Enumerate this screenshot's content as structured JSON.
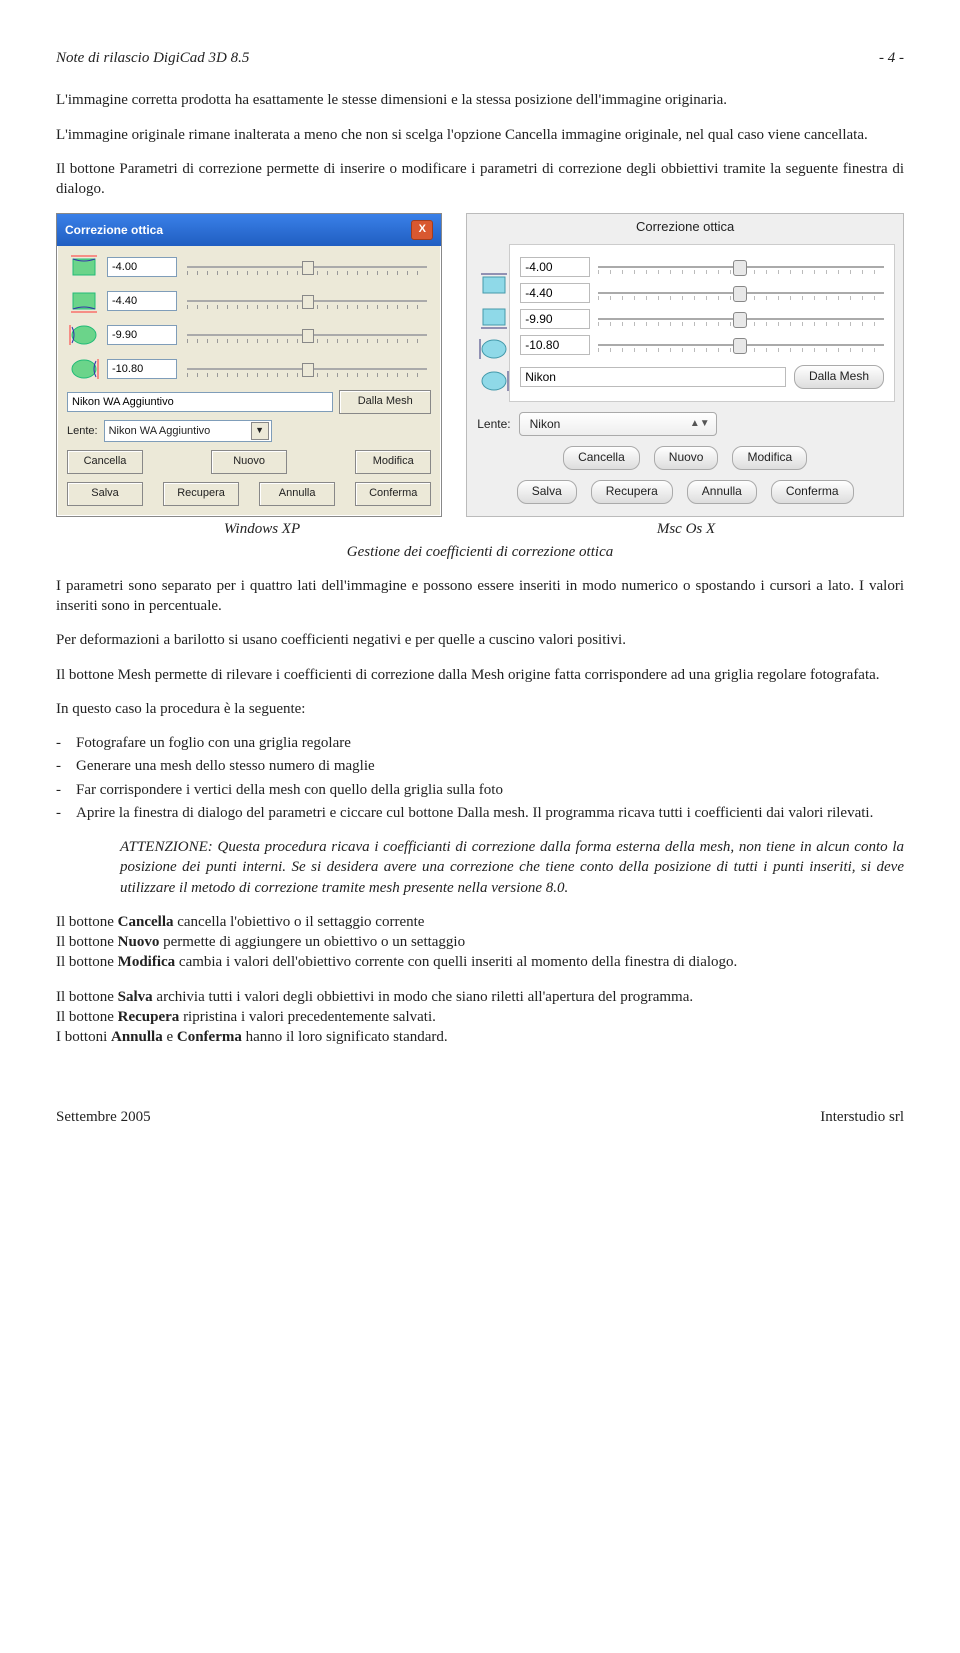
{
  "header": {
    "title": "Note di rilascio DigiCad 3D 8.5",
    "page": "- 4 -"
  },
  "para1": "L'immagine corretta prodotta ha esattamente le stesse dimensioni e la stessa posizione dell'immagine originaria.",
  "para2": "L'immagine originale rimane inalterata a meno che non si scelga l'opzione Cancella immagine originale, nel qual caso viene cancellata.",
  "para3": "Il bottone Parametri di correzione permette di inserire o modificare i parametri di correzione degli obbiettivi tramite la seguente finestra di dialogo.",
  "xp": {
    "title": "Correzione ottica",
    "values": [
      "-4.00",
      "-4.40",
      "-9.90",
      "-10.80"
    ],
    "lensName": "Nikon WA Aggiuntivo",
    "btnMesh": "Dalla Mesh",
    "lenteLabel": "Lente:",
    "combo": "Nikon WA Aggiuntivo",
    "btns1": [
      "Cancella",
      "Nuovo",
      "Modifica"
    ],
    "btns2": [
      "Salva",
      "Recupera",
      "Annulla",
      "Conferma"
    ]
  },
  "mac": {
    "title": "Correzione ottica",
    "values": [
      "-4.00",
      "-4.40",
      "-9.90",
      "-10.80"
    ],
    "lensName": "Nikon",
    "btnMesh": "Dalla Mesh",
    "lenteLabel": "Lente:",
    "combo": "Nikon",
    "btns1": [
      "Cancella",
      "Nuovo",
      "Modifica"
    ],
    "btns2": [
      "Salva",
      "Recupera",
      "Annulla",
      "Conferma"
    ]
  },
  "captions": {
    "xp": "Windows XP",
    "mac": "Msc Os X",
    "sub": "Gestione dei coefficienti di correzione ottica"
  },
  "para4": "I parametri sono separato per i quattro lati dell'immagine e possono essere inseriti in modo numerico o spostando i cursori a lato. I valori inseriti sono in percentuale.",
  "para5": "Per deformazioni a barilotto si usano coefficienti negativi e per quelle a cuscino valori positivi.",
  "para6": "Il bottone Mesh permette di rilevare i coefficienti di correzione dalla Mesh origine fatta corrispondere ad una griglia regolare fotografata.",
  "para7": "In questo caso la procedura è la seguente:",
  "list": [
    "Fotografare un foglio con una griglia regolare",
    "Generare una mesh dello stesso numero di maglie",
    "Far corrispondere i vertici della mesh con quello della griglia sulla foto",
    "Aprire la finestra di dialogo del parametri e ciccare cul bottone Dalla mesh. Il programma ricava tutti i coefficienti dai valori rilevati."
  ],
  "note": "ATTENZIONE: Questa procedura ricava i coefficianti di correzione dalla forma esterna della mesh, non tiene in alcun conto la posizione dei punti interni. Se si desidera avere una correzione che tiene conto della posizione di tutti i punti inseriti, si deve utilizzare il metodo di correzione tramite mesh presente nella versione 8.0.",
  "para8a": "Il bottone ",
  "para8b": " cancella l'obiettivo o il settaggio corrente",
  "para9a": "Il bottone ",
  "para9b": " permette di aggiungere un obiettivo o un settaggio",
  "para10a": "Il bottone ",
  "para10b": " cambia i valori dell'obiettivo corrente con quelli inseriti al momento della finestra di dialogo.",
  "para11a": "Il bottone ",
  "para11b": " archivia tutti i valori degli obbiettivi in modo che siano riletti all'apertura del programma.",
  "para12a": "Il bottone ",
  "para12b": " ripristina i valori precedentemente salvati.",
  "para13a": "I bottoni ",
  "para13b": " e ",
  "para13c": " hanno il loro significato standard.",
  "bold": {
    "cancella": "Cancella",
    "nuovo": "Nuovo",
    "modifica": "Modifica",
    "salva": "Salva",
    "recupera": "Recupera",
    "annulla": "Annulla",
    "conferma": "Conferma"
  },
  "footer": {
    "left": "Settembre 2005",
    "right": "Interstudio srl"
  }
}
